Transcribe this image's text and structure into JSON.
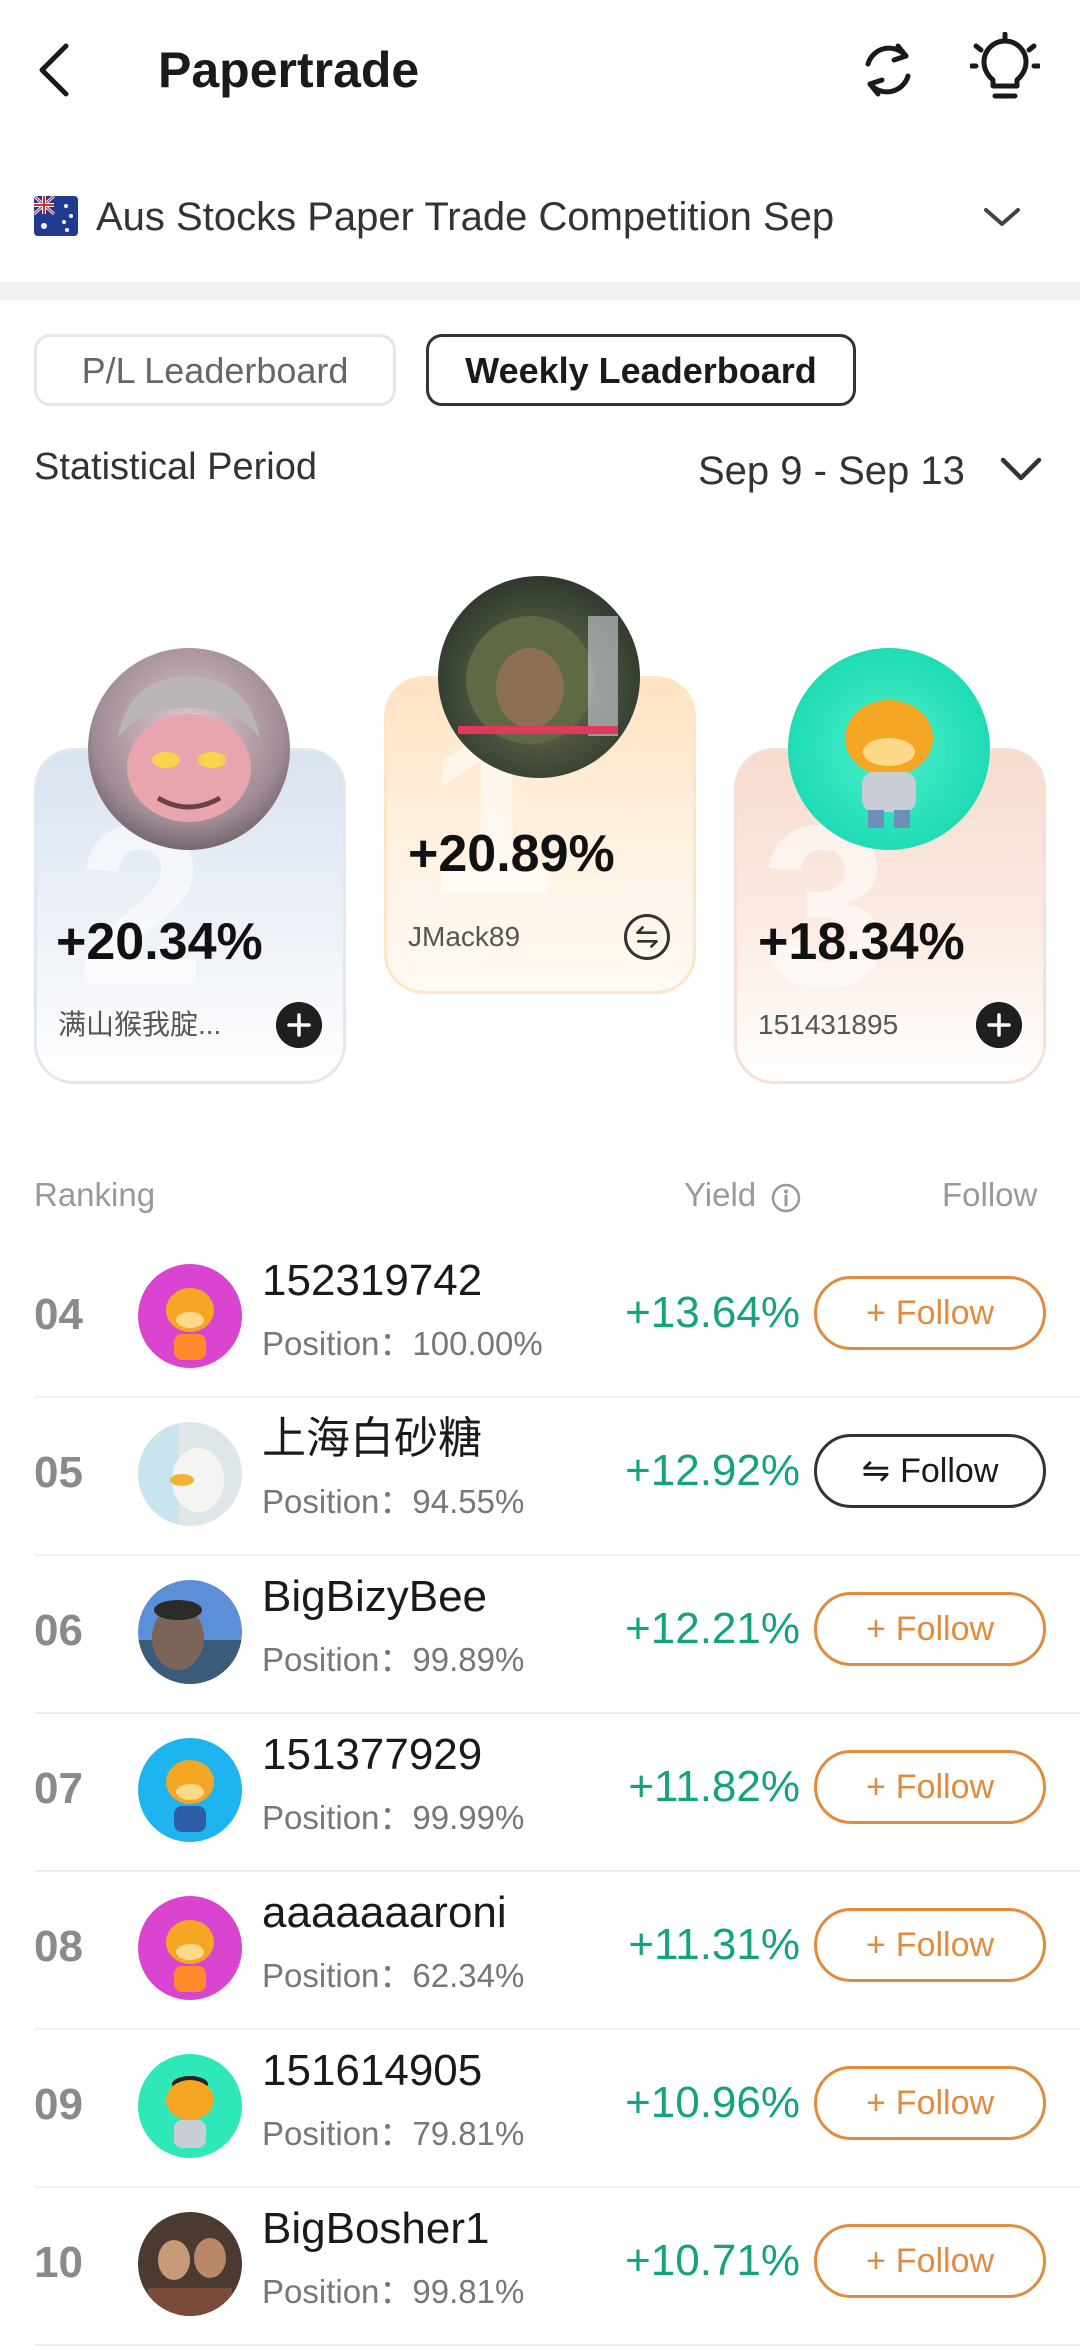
{
  "header": {
    "title": "Papertrade"
  },
  "competition": {
    "label": "Aus Stocks Paper Trade Competition Sep"
  },
  "tabs": [
    {
      "label": "P/L Leaderboard",
      "active": false
    },
    {
      "label": "Weekly Leaderboard",
      "active": true
    }
  ],
  "period": {
    "label": "Statistical Period",
    "value": "Sep 9 - Sep 13"
  },
  "podium": [
    {
      "rank": "1",
      "yield": "+20.89%",
      "name": "JMack89",
      "followed": true
    },
    {
      "rank": "2",
      "yield": "+20.34%",
      "name": "满山猴我腚...",
      "followed": false
    },
    {
      "rank": "3",
      "yield": "+18.34%",
      "name": "151431895",
      "followed": false
    }
  ],
  "table": {
    "headers": {
      "ranking": "Ranking",
      "yield": "Yield",
      "follow": "Follow"
    },
    "rows": [
      {
        "rank": "04",
        "name": "152319742",
        "position_label": "Position：",
        "position": "100.00%",
        "yield": "+13.64%",
        "follow_label": "Follow",
        "following": false
      },
      {
        "rank": "05",
        "name": "上海白砂糖",
        "position_label": "Position：",
        "position": "94.55%",
        "yield": "+12.92%",
        "follow_label": "Follow",
        "following": true
      },
      {
        "rank": "06",
        "name": "BigBizyBee",
        "position_label": "Position：",
        "position": "99.89%",
        "yield": "+12.21%",
        "follow_label": "Follow",
        "following": false
      },
      {
        "rank": "07",
        "name": "151377929",
        "position_label": "Position：",
        "position": "99.99%",
        "yield": "+11.82%",
        "follow_label": "Follow",
        "following": false
      },
      {
        "rank": "08",
        "name": "aaaaaaaroni",
        "position_label": "Position：",
        "position": "62.34%",
        "yield": "+11.31%",
        "follow_label": "Follow",
        "following": false
      },
      {
        "rank": "09",
        "name": "151614905",
        "position_label": "Position：",
        "position": "79.81%",
        "yield": "+10.96%",
        "follow_label": "Follow",
        "following": false
      },
      {
        "rank": "10",
        "name": "BigBosher1",
        "position_label": "Position：",
        "position": "99.81%",
        "yield": "+10.71%",
        "follow_label": "Follow",
        "following": false
      }
    ]
  },
  "colors": {
    "gain": "#14a37f",
    "follow_accent": "#e38b3c"
  },
  "icons": {
    "back": "back-icon",
    "refresh": "refresh-icon",
    "idea": "lightbulb-icon",
    "dropdown": "chevron-down-icon",
    "info": "info-icon",
    "follow": "plus-icon",
    "following": "swap-icon"
  }
}
